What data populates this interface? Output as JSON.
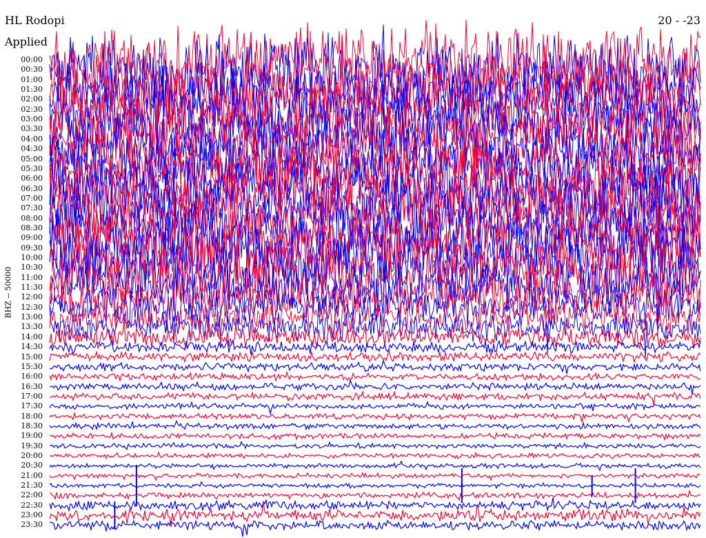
{
  "header": {
    "station": "HL Rodopi",
    "filter_label": "Applied",
    "date": "20    -    -23"
  },
  "channel_label": "BHZ -- 50000",
  "colors": {
    "trace_a": "#ff0033",
    "trace_b": "#0000ff"
  },
  "chart_data": {
    "type": "line",
    "title": "",
    "subtitle": "",
    "xlabel": "",
    "ylabel": "BHZ -- 50000",
    "y_ticks": [
      "00:00",
      "00:30",
      "01:00",
      "01:30",
      "02:00",
      "02:30",
      "03:00",
      "03:30",
      "04:00",
      "04:30",
      "05:00",
      "05:30",
      "06:00",
      "06:30",
      "07:00",
      "07:30",
      "08:00",
      "08:30",
      "09:00",
      "09:30",
      "10:00",
      "10:30",
      "11:00",
      "11:30",
      "12:00",
      "12:30",
      "13:00",
      "13:30",
      "14:00",
      "14:30",
      "15:00",
      "15:30",
      "16:00",
      "16:30",
      "17:00",
      "17:30",
      "18:00",
      "18:30",
      "19:00",
      "19:30",
      "20:00",
      "20:30",
      "21:00",
      "21:30",
      "22:00",
      "22:30",
      "23:00",
      "23:30"
    ],
    "row_color_cycle": [
      "#ff0033",
      "#0000ff"
    ],
    "row_amplitude": [
      60,
      60,
      60,
      60,
      60,
      60,
      60,
      60,
      60,
      60,
      60,
      60,
      60,
      60,
      60,
      60,
      60,
      60,
      60,
      60,
      60,
      60,
      60,
      45,
      40,
      35,
      30,
      25,
      18,
      10,
      8,
      7,
      6,
      6,
      6,
      5,
      5,
      5,
      5,
      4,
      4,
      4,
      4,
      4,
      5,
      8,
      10,
      8
    ],
    "events": [
      {
        "time": "21:30",
        "offset_min": 4,
        "amplitude": 30
      },
      {
        "time": "21:30",
        "offset_min": 25,
        "amplitude": 15
      },
      {
        "time": "21:30",
        "offset_min": 19,
        "amplitude": 25
      },
      {
        "time": "21:30",
        "offset_min": 27,
        "amplitude": 25
      },
      {
        "time": "23:00",
        "offset_min": 3,
        "amplitude": 20
      }
    ],
    "grid": false,
    "legend": "none"
  }
}
